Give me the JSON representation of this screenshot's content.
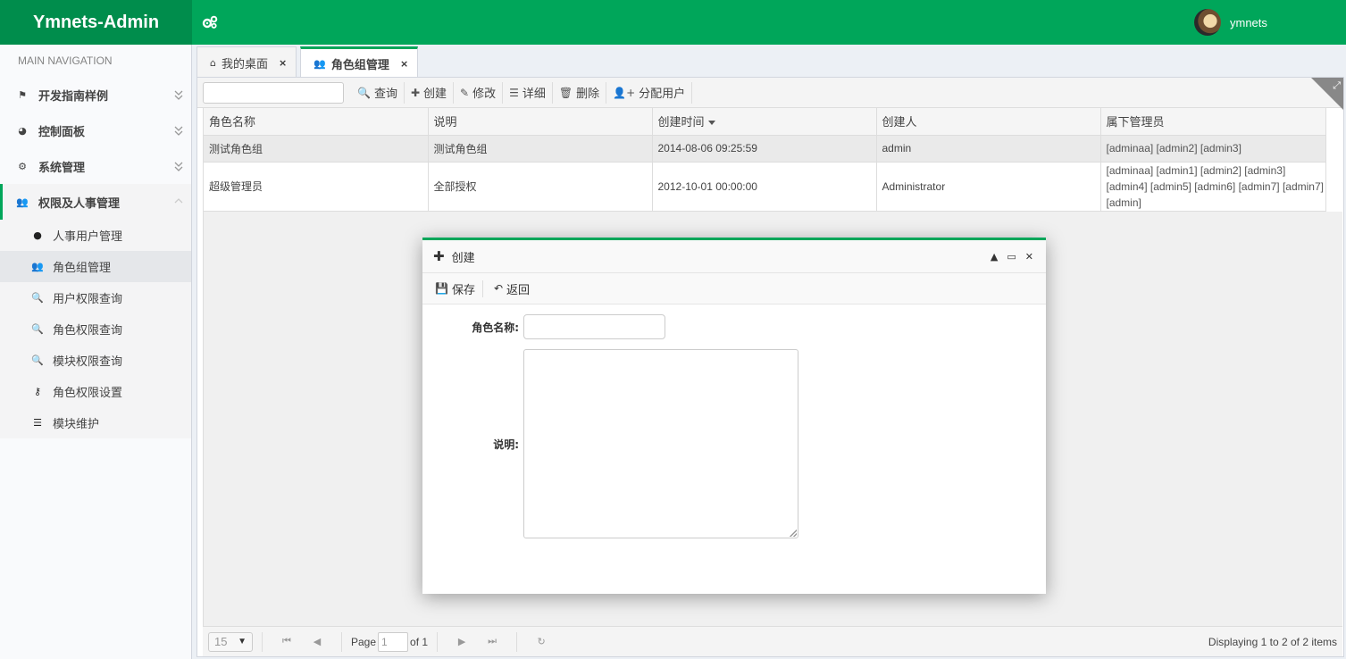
{
  "app": {
    "title": "Ymnets-Admin",
    "user_name": "ymnets",
    "accent": "#00a65a"
  },
  "sidebar": {
    "header": "MAIN NAVIGATION",
    "items": [
      {
        "label": "开发指南样例",
        "icon": "flag-icon"
      },
      {
        "label": "控制面板",
        "icon": "dashboard-icon"
      },
      {
        "label": "系统管理",
        "icon": "gears-icon"
      },
      {
        "label": "权限及人事管理",
        "icon": "users-icon"
      }
    ],
    "subitems": [
      {
        "label": "人事用户管理",
        "icon": "user-icon"
      },
      {
        "label": "角色组管理",
        "icon": "users-icon"
      },
      {
        "label": "用户权限查询",
        "icon": "search-icon"
      },
      {
        "label": "角色权限查询",
        "icon": "search-icon"
      },
      {
        "label": "模块权限查询",
        "icon": "search-icon"
      },
      {
        "label": "角色权限设置",
        "icon": "key-icon"
      },
      {
        "label": "模块维护",
        "icon": "list-icon"
      }
    ]
  },
  "tabs": [
    {
      "label": "我的桌面",
      "icon": "home-icon"
    },
    {
      "label": "角色组管理",
      "icon": "users-icon"
    }
  ],
  "toolbar": {
    "search_value": "",
    "buttons": [
      "查询",
      "创建",
      "修改",
      "详细",
      "删除",
      "分配用户"
    ]
  },
  "grid": {
    "columns": [
      "角色名称",
      "说明",
      "创建时间",
      "创建人",
      "属下管理员"
    ],
    "rows": [
      [
        "测试角色组",
        "测试角色组",
        "2014-08-06 09:25:59",
        "admin",
        "[adminaa] [admin2] [admin3]"
      ],
      [
        "超级管理员",
        "全部授权",
        "2012-10-01 00:00:00",
        "Administrator",
        "[adminaa] [admin1] [admin2] [admin3] [admin4] [admin5] [admin6] [admin7] [admin7] [admin]"
      ]
    ]
  },
  "pager": {
    "page_size": "15",
    "page_label": "Page",
    "page_value": "1",
    "of_label": "of 1",
    "info": "Displaying 1 to 2 of 2 items"
  },
  "dialog": {
    "title": "创建",
    "save_label": "保存",
    "back_label": "返回",
    "name_label": "角色名称:",
    "name_value": "",
    "desc_label": "说明:",
    "desc_value": ""
  }
}
